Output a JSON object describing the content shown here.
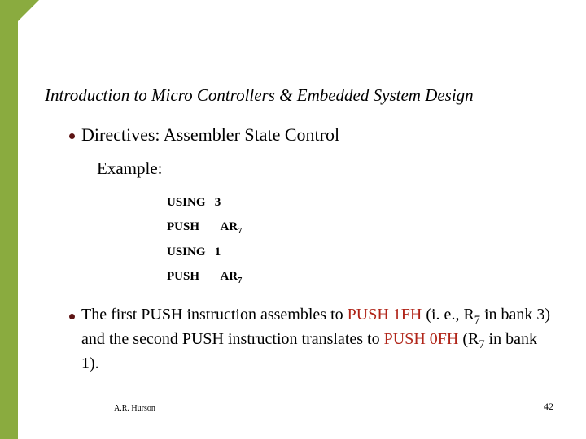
{
  "title": "Introduction to Micro Controllers & Embedded System Design",
  "bullet1": "Directives: Assembler State Control",
  "example_label": "Example:",
  "code": {
    "l1a": "USING",
    "l1b": "3",
    "l2a": "PUSH",
    "l2b": "AR",
    "l2sub": "7",
    "l3a": "USING",
    "l3b": "1",
    "l4a": "PUSH",
    "l4b": "AR",
    "l4sub": "7"
  },
  "para": {
    "t1": "The first PUSH instruction assembles to ",
    "r1": "PUSH   1FH",
    "t2": " (i. e., R",
    "sub1": "7",
    "t3": " in bank 3) and the second PUSH instruction translates to ",
    "r2": "PUSH   0FH",
    "t4": " (R",
    "sub2": "7",
    "t5": " in bank 1)."
  },
  "footer": {
    "author": "A.R. Hurson",
    "page": "42"
  }
}
